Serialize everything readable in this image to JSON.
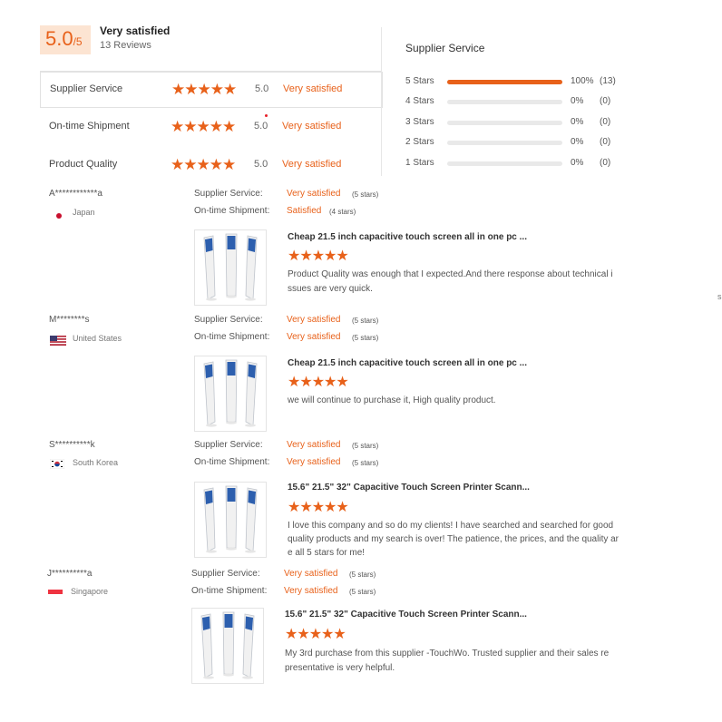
{
  "summary": {
    "score": "5.0",
    "score_max": "/5",
    "overall_label": "Very satisfied",
    "review_count": "13 Reviews"
  },
  "ratings": [
    {
      "label": "Supplier Service",
      "stars": "★★★★★",
      "value": "5.0",
      "text": "Very satisfied"
    },
    {
      "label": "On-time Shipment",
      "stars": "★★★★★",
      "value": "5.0",
      "text": "Very satisfied"
    },
    {
      "label": "Product Quality",
      "stars": "★★★★★",
      "value": "5.0",
      "text": "Very satisfied"
    }
  ],
  "distribution": {
    "title": "Supplier Service",
    "rows": [
      {
        "label": "5 Stars",
        "fraction": 1.0,
        "pct": "100%",
        "count": "(13)"
      },
      {
        "label": "4 Stars",
        "fraction": 0,
        "pct": "0%",
        "count": "(0)"
      },
      {
        "label": "3 Stars",
        "fraction": 0,
        "pct": "0%",
        "count": "(0)"
      },
      {
        "label": "2 Stars",
        "fraction": 0,
        "pct": "0%",
        "count": "(0)"
      },
      {
        "label": "1 Stars",
        "fraction": 0,
        "pct": "0%",
        "count": "(0)"
      }
    ]
  },
  "review_keys": {
    "supplier": "Supplier Service:",
    "shipment": "On-time Shipment:"
  },
  "reviews": [
    {
      "user": "A************a",
      "country": "Japan",
      "flag_icon": "japan-flag-icon",
      "supplier_value": "Very satisfied",
      "supplier_sub": "(5 stars)",
      "shipment_value": "Satisfied",
      "shipment_sub": "(4 stars)",
      "product": "Cheap 21.5 inch capacitive touch screen all in one pc ...",
      "stars": "★★★★★",
      "text_lines": [
        "Product Quality was enough that I expected.And there response about technical i",
        "ssues are very quick."
      ]
    },
    {
      "user": "M********s",
      "country": "United States",
      "flag_icon": "us-flag-icon",
      "supplier_value": "Very satisfied",
      "supplier_sub": "(5 stars)",
      "shipment_value": "Very satisfied",
      "shipment_sub": "(5 stars)",
      "product": "Cheap 21.5 inch capacitive touch screen all in one pc ...",
      "stars": "★★★★★",
      "text_lines": [
        "we will continue to purchase it, High quality product."
      ]
    },
    {
      "user": "S**********k",
      "country": "South Korea",
      "flag_icon": "south-korea-flag-icon",
      "supplier_value": "Very satisfied",
      "supplier_sub": "(5 stars)",
      "shipment_value": "Very satisfied",
      "shipment_sub": "(5 stars)",
      "product": "15.6\" 21.5\" 32\" Capacitive Touch Screen Printer Scann...",
      "stars": "★★★★★",
      "text_lines": [
        "I love this company and so do my clients! I have searched and searched for good",
        "quality products and my search is over! The patience, the prices, and the quality ar",
        "e all 5 stars for me!"
      ]
    },
    {
      "user": "J**********a",
      "country": "Singapore",
      "flag_icon": "singapore-flag-icon",
      "supplier_value": "Very satisfied",
      "supplier_sub": "(5 stars)",
      "shipment_value": "Very satisfied",
      "shipment_sub": "(5 stars)",
      "product": "15.6\" 21.5\" 32\" Capacitive Touch Screen Printer Scann...",
      "stars": "★★★★★",
      "text_lines": [
        "My 3rd purchase from this supplier -TouchWo. Trusted supplier and their sales re",
        "presentative is very helpful."
      ]
    }
  ],
  "edge_mark": "s",
  "colors": {
    "accent": "#e8611a",
    "score_bg": "#fce4d2"
  }
}
